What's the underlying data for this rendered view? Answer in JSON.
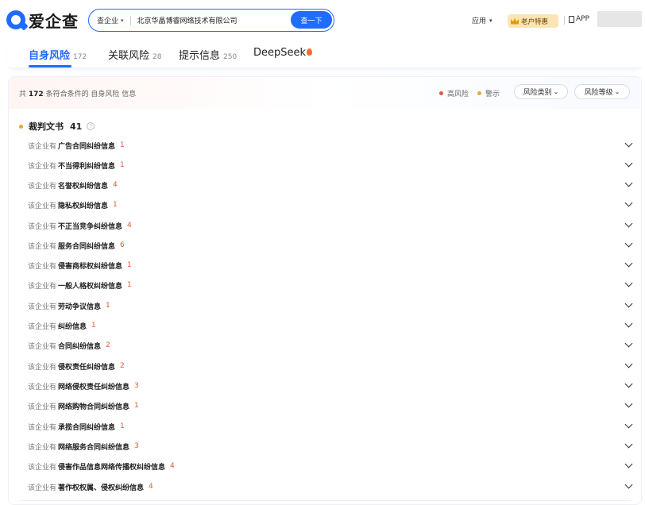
{
  "header": {
    "logo_text": "爱企查",
    "search": {
      "type_label": "查企业",
      "query": "北京华晶博睿网络技术有限公司",
      "button_label": "查一下"
    },
    "apps_label": "应用",
    "vip_label": "老户特惠",
    "app_label": "APP"
  },
  "tabs": [
    {
      "label": "自身风险",
      "count": "172"
    },
    {
      "label": "关联风险",
      "count": "28"
    },
    {
      "label": "提示信息",
      "count": "250"
    },
    {
      "label": "DeepSeek",
      "count": ""
    }
  ],
  "summary": {
    "prefix": "共",
    "count": "172",
    "suffix": "条符合条件的 自身风险 信息"
  },
  "legend": {
    "high": "高风险",
    "warn": "警示",
    "high_color": "#e8544d",
    "warn_color": "#f2a33a"
  },
  "filters": {
    "category": "风险类别",
    "level": "风险等级"
  },
  "section": {
    "title": "裁判文书",
    "count": "41",
    "help": "?"
  },
  "rows": [
    {
      "pre": "该企业有",
      "name": "广告合同纠纷信息",
      "count": "1"
    },
    {
      "pre": "该企业有",
      "name": "不当得利纠纷信息",
      "count": "1"
    },
    {
      "pre": "该企业有",
      "name": "名誉权纠纷信息",
      "count": "4"
    },
    {
      "pre": "该企业有",
      "name": "隐私权纠纷信息",
      "count": "1"
    },
    {
      "pre": "该企业有",
      "name": "不正当竞争纠纷信息",
      "count": "4"
    },
    {
      "pre": "该企业有",
      "name": "服务合同纠纷信息",
      "count": "6"
    },
    {
      "pre": "该企业有",
      "name": "侵害商标权纠纷信息",
      "count": "1"
    },
    {
      "pre": "该企业有",
      "name": "一般人格权纠纷信息",
      "count": "1"
    },
    {
      "pre": "该企业有",
      "name": "劳动争议信息",
      "count": "1"
    },
    {
      "pre": "该企业有",
      "name": "纠纷信息",
      "count": "1"
    },
    {
      "pre": "该企业有",
      "name": "合同纠纷信息",
      "count": "2"
    },
    {
      "pre": "该企业有",
      "name": "侵权责任纠纷信息",
      "count": "2"
    },
    {
      "pre": "该企业有",
      "name": "网络侵权责任纠纷信息",
      "count": "3"
    },
    {
      "pre": "该企业有",
      "name": "网络购物合同纠纷信息",
      "count": "1"
    },
    {
      "pre": "该企业有",
      "name": "承揽合同纠纷信息",
      "count": "1"
    },
    {
      "pre": "该企业有",
      "name": "网络服务合同纠纷信息",
      "count": "3"
    },
    {
      "pre": "该企业有",
      "name": "侵害作品信息网络传播权纠纷信息",
      "count": "4"
    },
    {
      "pre": "该企业有",
      "name": "著作权权属、侵权纠纷信息",
      "count": "4"
    }
  ]
}
